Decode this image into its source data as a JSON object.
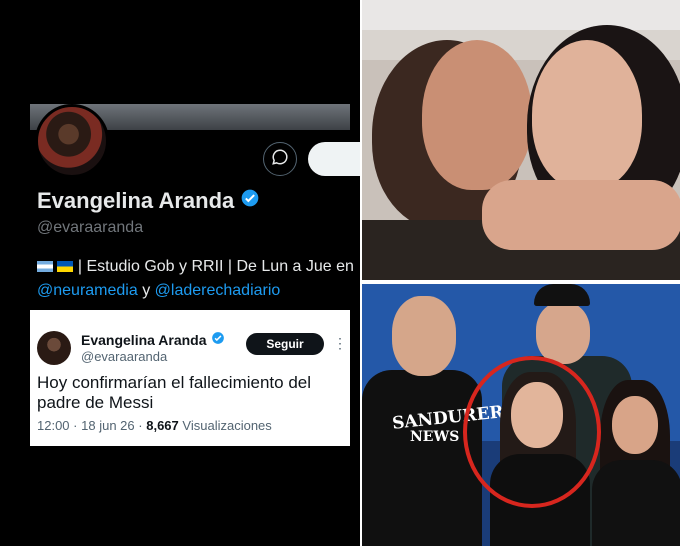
{
  "profile": {
    "name": "Evangelina Aranda",
    "handle": "@evaraaranda",
    "bio_text": "| Estudio Gob y RRII | De Lun a Jue en",
    "bio_link1": "@neuramedia",
    "bio_connector": "y",
    "bio_link2": "@laderechadiario"
  },
  "tweet": {
    "author_name": "Evangelina Aranda",
    "author_handle": "@evaraaranda",
    "follow_label": "Seguir",
    "more_icon": "⋮",
    "text": "Hoy confirmarían el fallecimiento del padre de Messi",
    "time": "12:00",
    "dot": "·",
    "date": "18 jun 26",
    "views_count": "8,667",
    "views_label": "Visualizaciones"
  },
  "photo2": {
    "shirt_line1": "SANDURER",
    "shirt_line2": "NEWS"
  },
  "colors": {
    "verified": "#1d9bf0",
    "link": "#1d9bf0",
    "highlight_circle": "#d7261e"
  },
  "icons": [
    "message-icon",
    "verified-badge-icon",
    "argentina-flag-icon",
    "ukraine-flag-icon",
    "more-options-icon"
  ]
}
